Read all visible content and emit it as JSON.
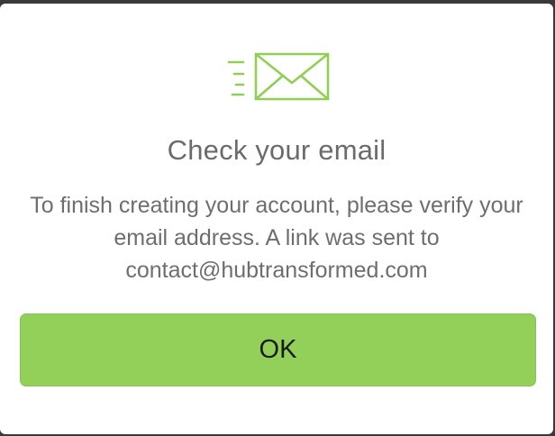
{
  "dialog": {
    "icon": "envelope-sent-icon",
    "title": "Check your email",
    "message": "To finish creating your account, please verify your email address. A link was sent to contact@hubtransformed.com",
    "ok_label": "OK"
  },
  "colors": {
    "accent_green": "#92d05a",
    "icon_green": "#8fcf55",
    "text_gray": "#6b6b6b"
  }
}
